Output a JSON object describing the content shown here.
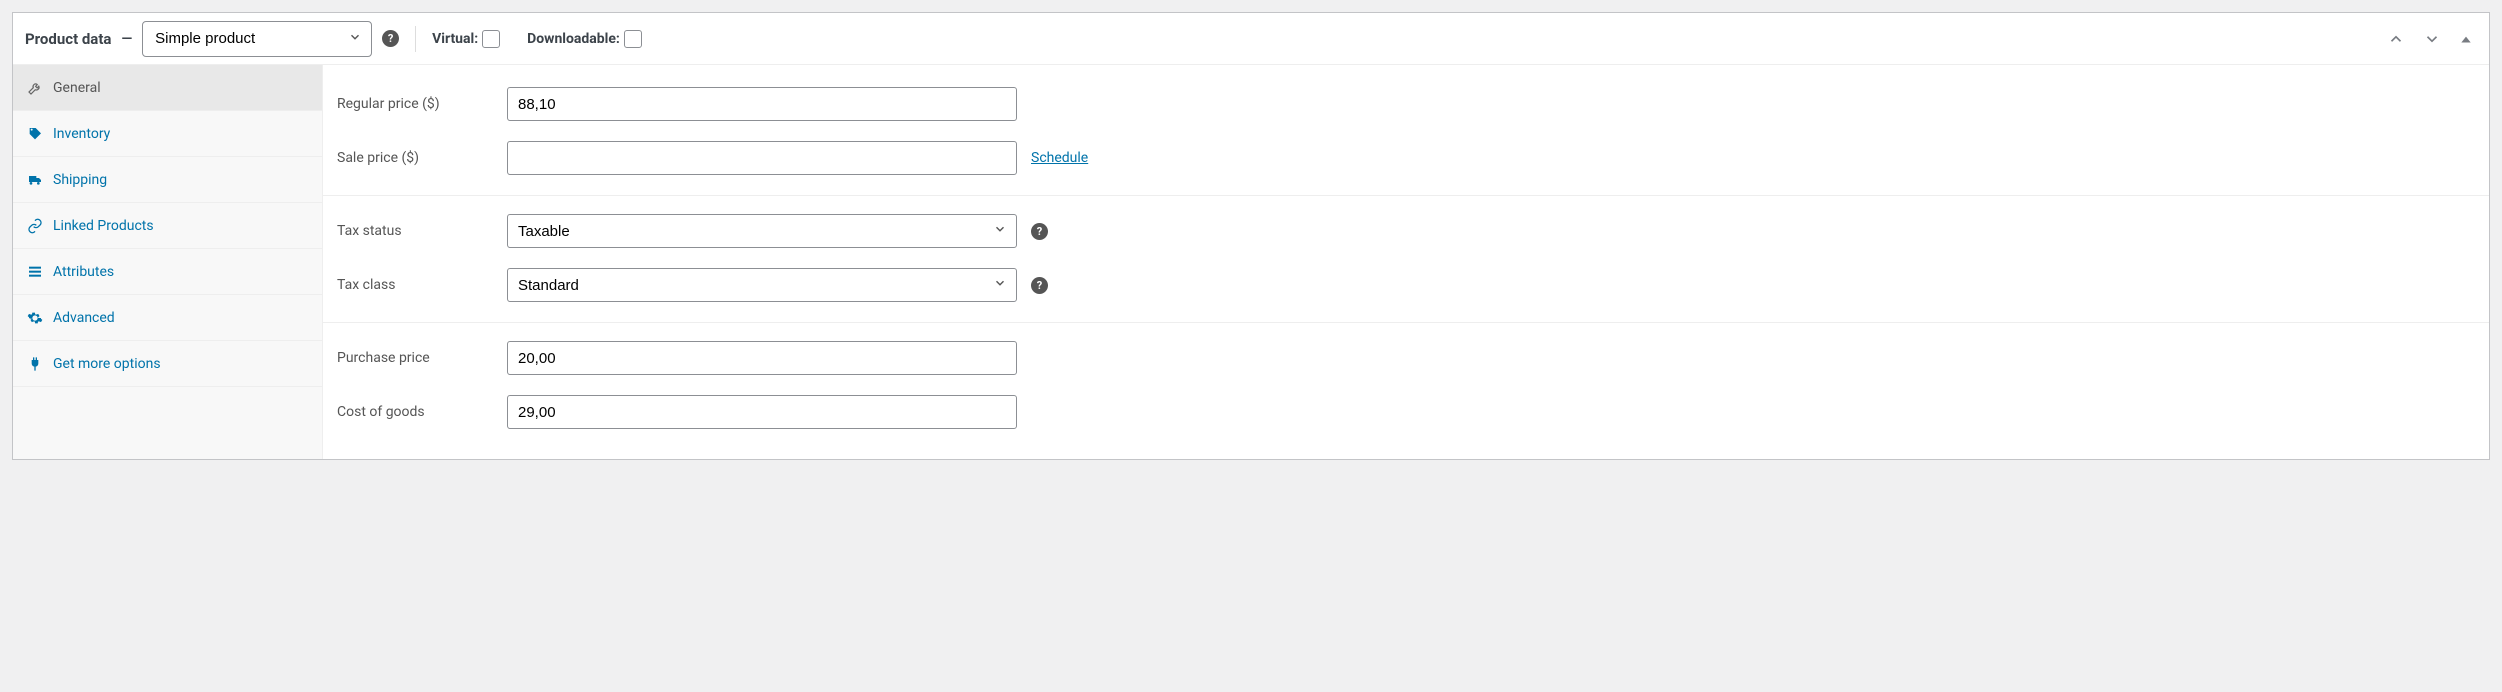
{
  "header": {
    "title": "Product data",
    "dash": "—",
    "product_type": "Simple product",
    "virtual_label": "Virtual:",
    "downloadable_label": "Downloadable:"
  },
  "tabs": {
    "general": "General",
    "inventory": "Inventory",
    "shipping": "Shipping",
    "linked": "Linked Products",
    "attributes": "Attributes",
    "advanced": "Advanced",
    "more": "Get more options"
  },
  "fields": {
    "regular_price": {
      "label": "Regular price ($)",
      "value": "88,10"
    },
    "sale_price": {
      "label": "Sale price ($)",
      "value": "",
      "schedule": "Schedule"
    },
    "tax_status": {
      "label": "Tax status",
      "value": "Taxable"
    },
    "tax_class": {
      "label": "Tax class",
      "value": "Standard"
    },
    "purchase_price": {
      "label": "Purchase price",
      "value": "20,00"
    },
    "cost_of_goods": {
      "label": "Cost of goods",
      "value": "29,00"
    }
  }
}
